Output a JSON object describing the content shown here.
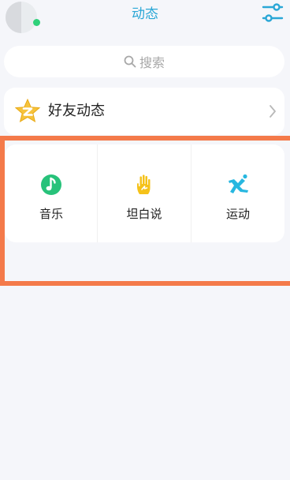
{
  "header": {
    "title": "动态",
    "filter_icon": "sliders-icon",
    "avatar_status_color": "#2fd17a"
  },
  "search": {
    "placeholder": "搜索",
    "icon": "search-icon"
  },
  "friends": {
    "label": "好友动态",
    "icon": "qzone-star-icon",
    "chevron": "chevron-right-icon"
  },
  "apps": [
    {
      "label": "音乐",
      "icon": "music-note-icon",
      "color": "#27c27a"
    },
    {
      "label": "坦白说",
      "icon": "hand-icon",
      "color": "#f5c21a"
    },
    {
      "label": "运动",
      "icon": "running-icon",
      "color": "#27b7e0"
    }
  ],
  "highlight_color": "#f47a4a"
}
